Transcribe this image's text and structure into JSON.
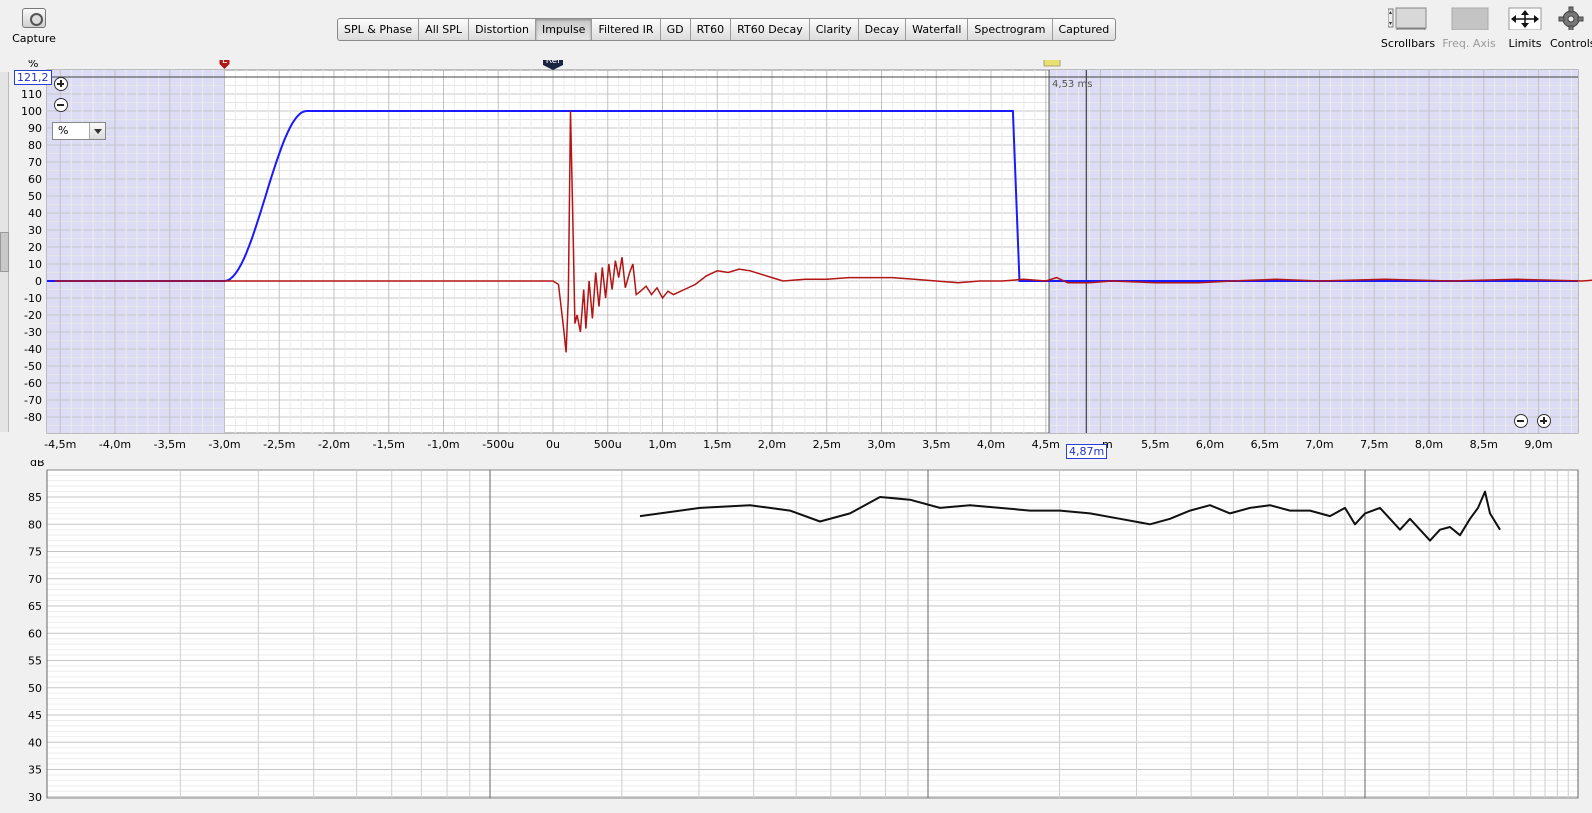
{
  "toolbar": {
    "capture_label": "Capture",
    "tabs": [
      {
        "label": "SPL & Phase"
      },
      {
        "label": "All SPL"
      },
      {
        "label": "Distortion"
      },
      {
        "label": "Impulse",
        "active": true
      },
      {
        "label": "Filtered IR"
      },
      {
        "label": "GD"
      },
      {
        "label": "RT60"
      },
      {
        "label": "RT60 Decay"
      },
      {
        "label": "Clarity"
      },
      {
        "label": "Decay"
      },
      {
        "label": "Waterfall"
      },
      {
        "label": "Spectrogram"
      },
      {
        "label": "Captured"
      }
    ],
    "right": {
      "scrollbars": "Scrollbars",
      "freq_axis": "Freq. Axis",
      "limits": "Limits",
      "controls": "Controls"
    }
  },
  "impulse_plot": {
    "y_unit": "%",
    "y_top_readout": "121,2",
    "unit_select_value": "%",
    "y_ticks": [
      "110",
      "100",
      "90",
      "80",
      "70",
      "60",
      "50",
      "40",
      "30",
      "20",
      "10",
      "0",
      "-10",
      "-20",
      "-30",
      "-40",
      "-50",
      "-60",
      "-70",
      "-80"
    ],
    "x_ticks": [
      "-4,5m",
      "-4,0m",
      "-3,5m",
      "-3,0m",
      "-2,5m",
      "-2,0m",
      "-1,5m",
      "-1,0m",
      "-500u",
      "0u",
      "500u",
      "1,0m",
      "1,5m",
      "2,0m",
      "2,5m",
      "3,0m",
      "3,5m",
      "4,0m",
      "4,5m",
      "",
      "5,5m",
      "6,0m",
      "6,5m",
      "7,0m",
      "7,5m",
      "8,0m",
      "8,5m",
      "9,0m"
    ],
    "x_cursor_readout": "4,87m",
    "x_cursor_suffix": "m",
    "marker_left": "L",
    "marker_ref": "Ref",
    "window_right_label": "4,53 ms",
    "colors": {
      "window": "#1a1aff",
      "impulse": "#b41414",
      "shade": "#dcdcf5"
    }
  },
  "freq_plot": {
    "y_unit": "dB",
    "y_ticks": [
      "85",
      "80",
      "75",
      "70",
      "65",
      "60",
      "55",
      "50",
      "45",
      "40",
      "35",
      "30"
    ],
    "trace_color": "#111111"
  },
  "icons": {
    "capture": "camera-icon",
    "scrollbars": "scrollbars-icon",
    "freq_axis": "freq-axis-icon",
    "limits": "limits-arrows-icon",
    "controls": "gear-icon"
  }
}
